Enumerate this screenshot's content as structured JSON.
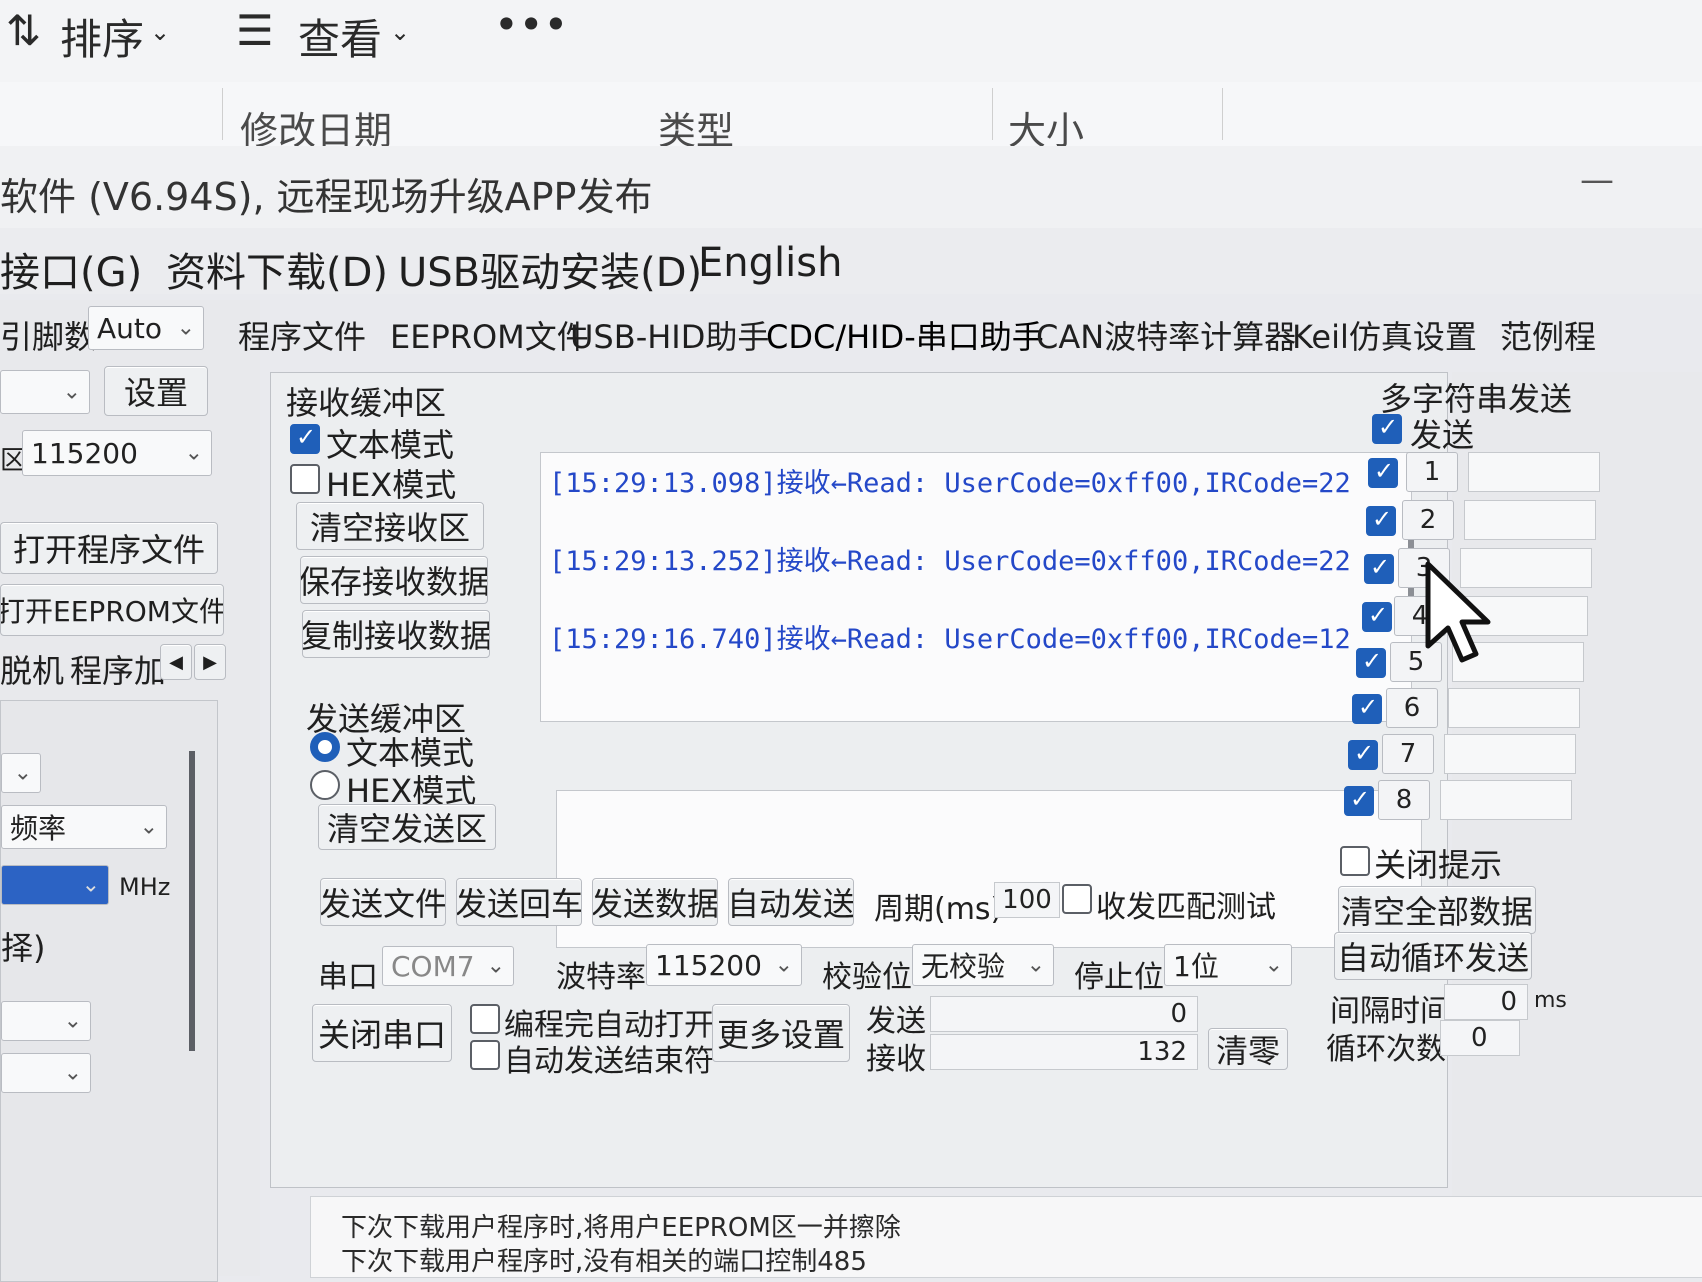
{
  "explorer": {
    "sort_label": "排序",
    "view_label": "查看",
    "more_label": "•••",
    "columns": [
      "修改日期",
      "类型",
      "大小"
    ]
  },
  "app": {
    "title": "软件 (V6.94S), 远程现场升级APP发布",
    "minimize": "—",
    "menu": [
      "接口(G)",
      "资料下载(D)",
      "USB驱动安装(D)",
      "English"
    ]
  },
  "left": {
    "pin_label": "引脚数",
    "pin_value": "Auto",
    "settings_button": "设置",
    "baud_prefix": "区",
    "baud_value": "115200",
    "open_program_button": "打开程序文件",
    "open_eeprom_button": "打开EEPROM文件",
    "offline_label": "脱机",
    "program_label": "程序加",
    "freq_label": "频率",
    "mhz_label": "MHz",
    "select_label": "择)"
  },
  "tabs": [
    "程序文件",
    "EEPROM文件",
    "USB-HID助手",
    "CDC/HID-串口助手",
    "CAN波特率计算器",
    "Keil仿真设置",
    "范例程"
  ],
  "receive": {
    "group_title": "接收缓冲区",
    "text_mode": "文本模式",
    "hex_mode": "HEX模式",
    "text_mode_checked": true,
    "hex_mode_checked": false,
    "clear_button": "清空接收区",
    "save_button": "保存接收数据",
    "copy_button": "复制接收数据",
    "lines": [
      "[15:29:13.098]接收←Read: UserCode=0xff00,IRCode=22",
      "[15:29:13.252]接收←Read: UserCode=0xff00,IRCode=22",
      "[15:29:16.740]接收←Read: UserCode=0xff00,IRCode=12"
    ]
  },
  "send": {
    "group_title": "发送缓冲区",
    "text_mode": "文本模式",
    "hex_mode": "HEX模式",
    "selected_mode": "文本模式",
    "clear_button": "清空发送区",
    "send_file": "发送文件",
    "send_enter": "发送回车",
    "send_data": "发送数据",
    "auto_send": "自动发送",
    "period_label": "周期(ms)",
    "period_value": "100",
    "match_test_label": "收发匹配测试",
    "match_test_checked": false
  },
  "port": {
    "port_label": "串口",
    "port_value": "COM7",
    "baud_label": "波特率",
    "baud_value": "115200",
    "parity_label": "校验位",
    "parity_value": "无校验",
    "stop_label": "停止位",
    "stop_value": "1位",
    "close_button": "关闭串口",
    "auto_open_label": "编程完自动打开",
    "auto_end_label": "自动发送结束符",
    "more_settings": "更多设置",
    "send_label": "发送",
    "send_count": "0",
    "recv_label": "接收",
    "recv_count": "132",
    "clear_count_button": "清零"
  },
  "multi": {
    "title": "多字符串发送",
    "send_label": "发送",
    "send_checked": true,
    "items": [
      "1",
      "2",
      "3",
      "4",
      "5",
      "6",
      "7",
      "8"
    ],
    "close_hint": "关闭提示",
    "clear_all": "清空全部数据",
    "auto_loop": "自动循环发送",
    "interval_label": "间隔时间",
    "interval_value": "0",
    "interval_unit": "ms",
    "loop_label": "循环次数",
    "loop_value": "0"
  },
  "log": [
    "下次下载用户程序时,将用户EEPROM区一并擦除",
    "下次下载用户程序时,没有相关的端口控制485"
  ],
  "colors": {
    "accent": "#1f5fb9",
    "receive_text": "#2448c8"
  }
}
